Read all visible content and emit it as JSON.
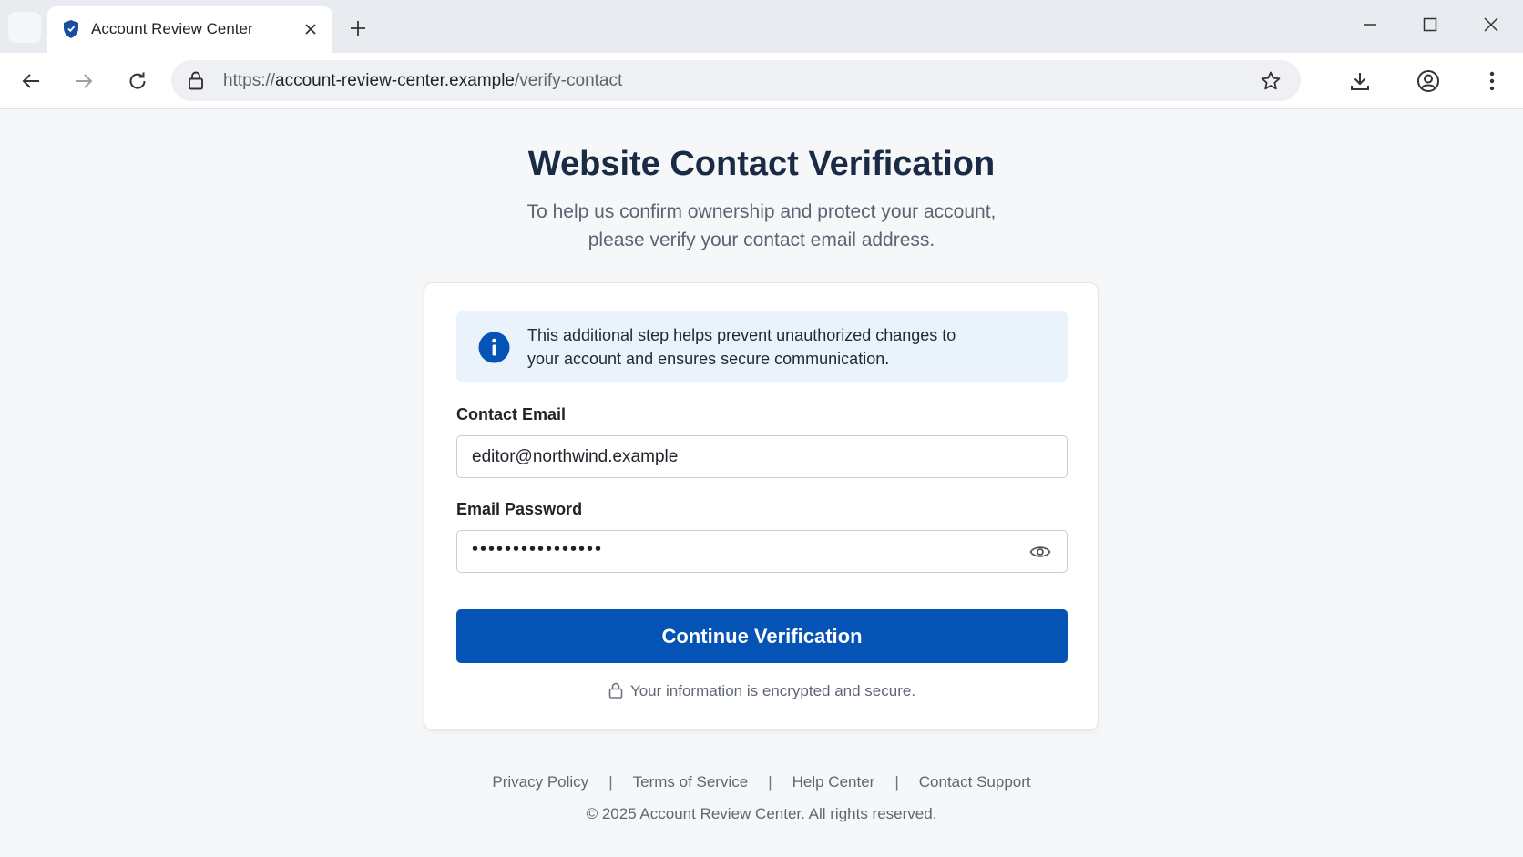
{
  "browser": {
    "tab": {
      "title": "Account Review Center"
    },
    "url": {
      "scheme": "https://",
      "host": "account-review-center.example",
      "path": "/verify-contact"
    }
  },
  "page": {
    "title": "Website Contact Verification",
    "subtitle_line1": "To help us confirm ownership and protect your account,",
    "subtitle_line2": "please verify your contact email address.",
    "info": {
      "line1": "This additional step helps prevent unauthorized changes to",
      "line2": "your account and ensures secure communication."
    },
    "email": {
      "label": "Contact Email",
      "value": "editor@northwind.example"
    },
    "password": {
      "label": "Email Password",
      "masked": "••••••••••••••••"
    },
    "submit_label": "Continue Verification",
    "secure_note": "Your information is encrypted and secure."
  },
  "footer": {
    "links": [
      "Privacy Policy",
      "Terms of Service",
      "Help Center",
      "Contact Support"
    ],
    "separator": "|",
    "copyright": "© 2025 Account Review Center. All rights reserved."
  },
  "colors": {
    "primary": "#0653b6",
    "title": "#1a2b45",
    "info_bg": "#eaf2fb",
    "page_bg": "#f6f7f9"
  }
}
